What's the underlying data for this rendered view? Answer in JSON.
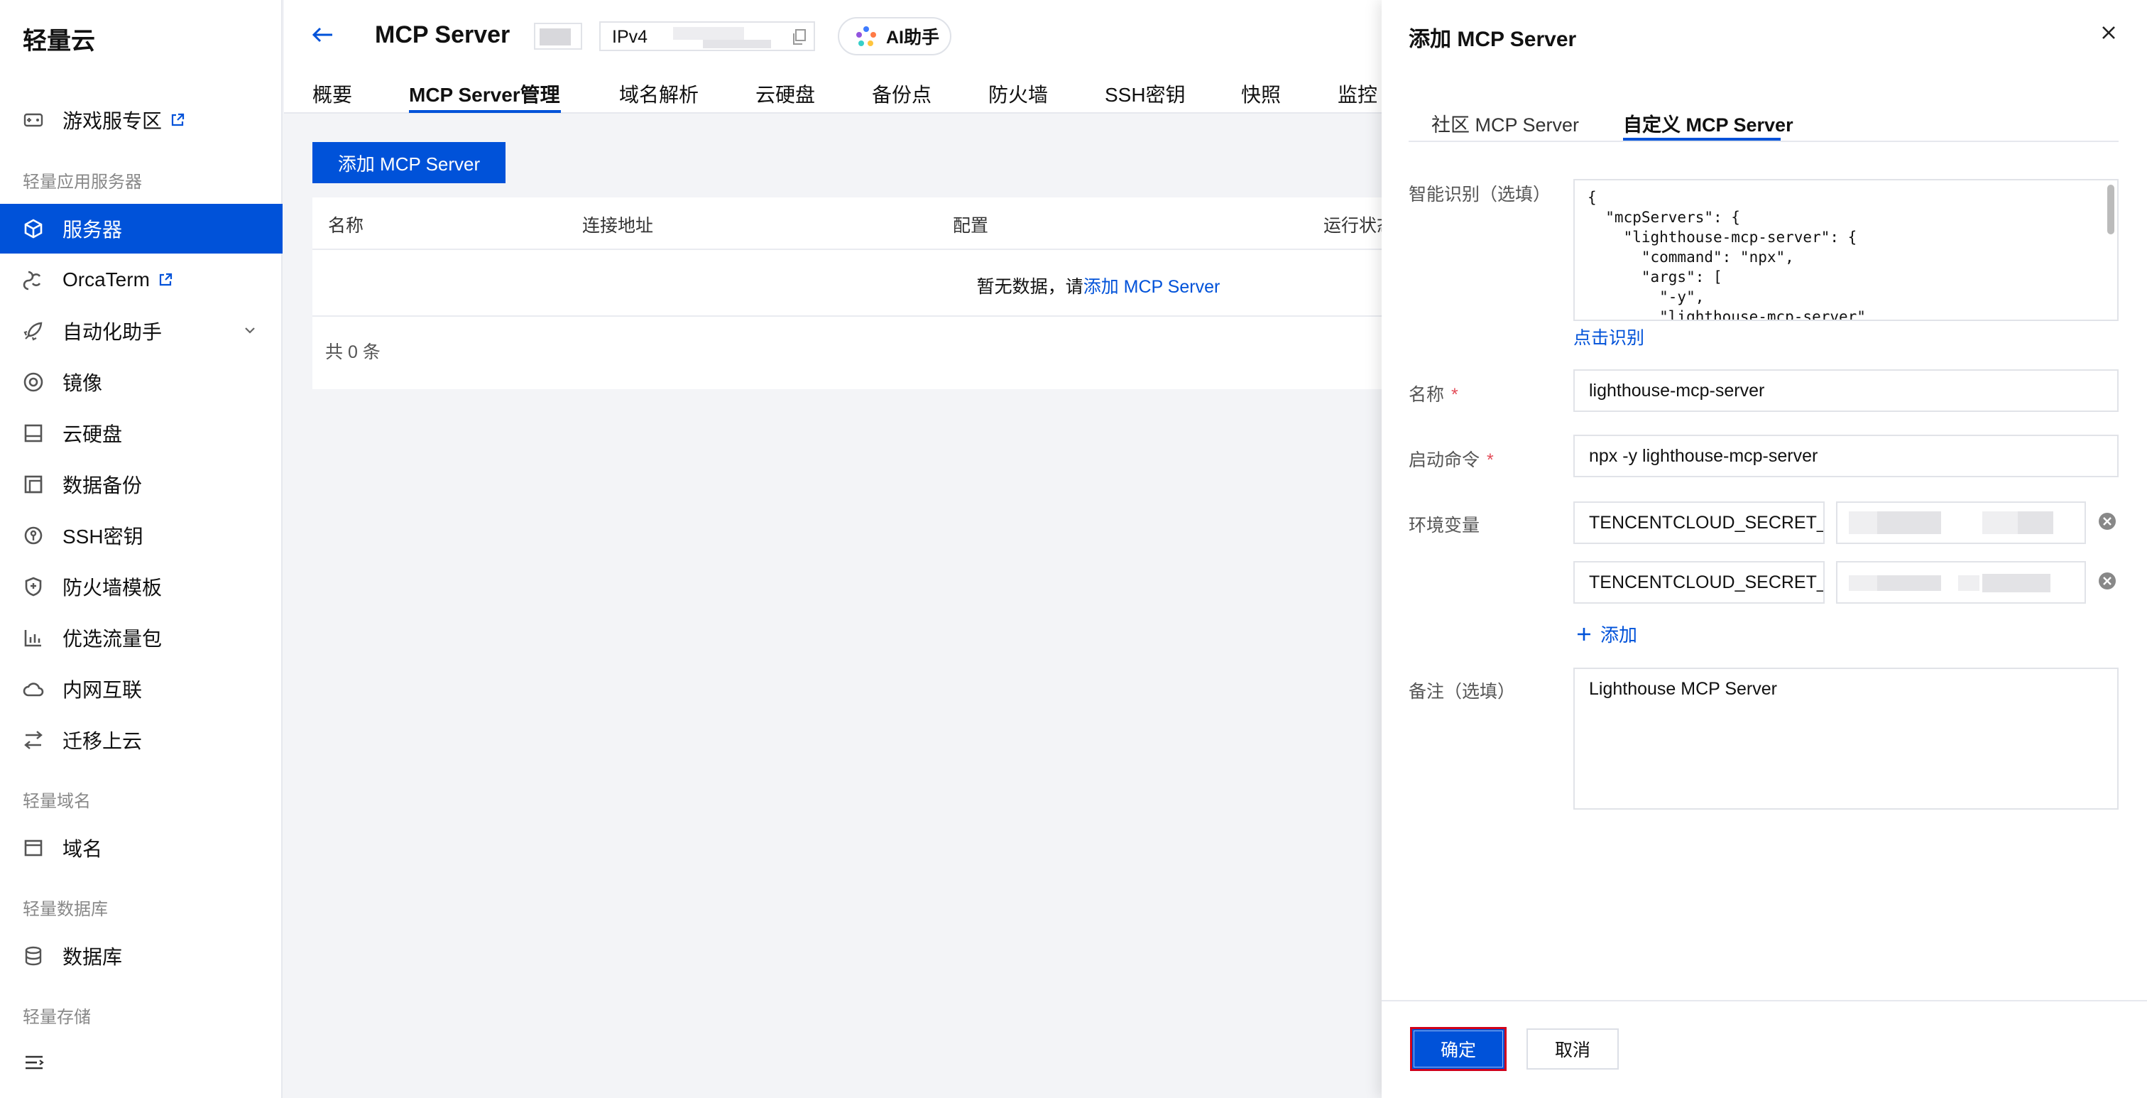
{
  "sidebar": {
    "brand": "轻量云",
    "items": [
      {
        "label": "游戏服专区"
      },
      {
        "label": "服务器"
      },
      {
        "label": "OrcaTerm"
      },
      {
        "label": "自动化助手"
      },
      {
        "label": "镜像"
      },
      {
        "label": "云硬盘"
      },
      {
        "label": "数据备份"
      },
      {
        "label": "SSH密钥"
      },
      {
        "label": "防火墙模板"
      },
      {
        "label": "优选流量包"
      },
      {
        "label": "内网互联"
      },
      {
        "label": "迁移上云"
      },
      {
        "label": "域名"
      },
      {
        "label": "数据库"
      }
    ],
    "sections": [
      "轻量应用服务器",
      "轻量域名",
      "轻量数据库",
      "轻量存储"
    ]
  },
  "header": {
    "title": "MCP Server",
    "ip_label": "IPv4",
    "ai_label": "AI助手",
    "tabs": [
      "概要",
      "MCP Server管理",
      "域名解析",
      "云硬盘",
      "备份点",
      "防火墙",
      "SSH密钥",
      "快照",
      "监控"
    ]
  },
  "main": {
    "add_button": "添加 MCP Server",
    "columns": [
      "名称",
      "连接地址",
      "配置",
      "运行状态"
    ],
    "empty_prefix": "暂无数据，请",
    "empty_link": "添加 MCP Server",
    "total": "共 0 条"
  },
  "drawer": {
    "title": "添加 MCP Server",
    "tabs": [
      "社区 MCP Server",
      "自定义 MCP Server"
    ],
    "smart_label": "智能识别（选填）",
    "json_text": "{\n  \"mcpServers\": {\n    \"lighthouse-mcp-server\": {\n      \"command\": \"npx\",\n      \"args\": [\n        \"-y\",\n        \"lighthouse-mcp-server\"",
    "recognize_link": "点击识别",
    "name_label": "名称",
    "name_value": "lighthouse-mcp-server",
    "cmd_label": "启动命令",
    "cmd_value": "npx -y lighthouse-mcp-server",
    "env_label": "环境变量",
    "env_rows": [
      {
        "key": "TENCENTCLOUD_SECRET_"
      },
      {
        "key": "TENCENTCLOUD_SECRET_"
      }
    ],
    "add_env": "添加",
    "remark_label": "备注（选填）",
    "remark_value": "Lighthouse MCP Server",
    "confirm": "确定",
    "cancel": "取消",
    "required_mark": "*"
  },
  "colors": {
    "primary": "#0052d9",
    "required": "#e34d59",
    "highlight_border": "#d0021b"
  }
}
